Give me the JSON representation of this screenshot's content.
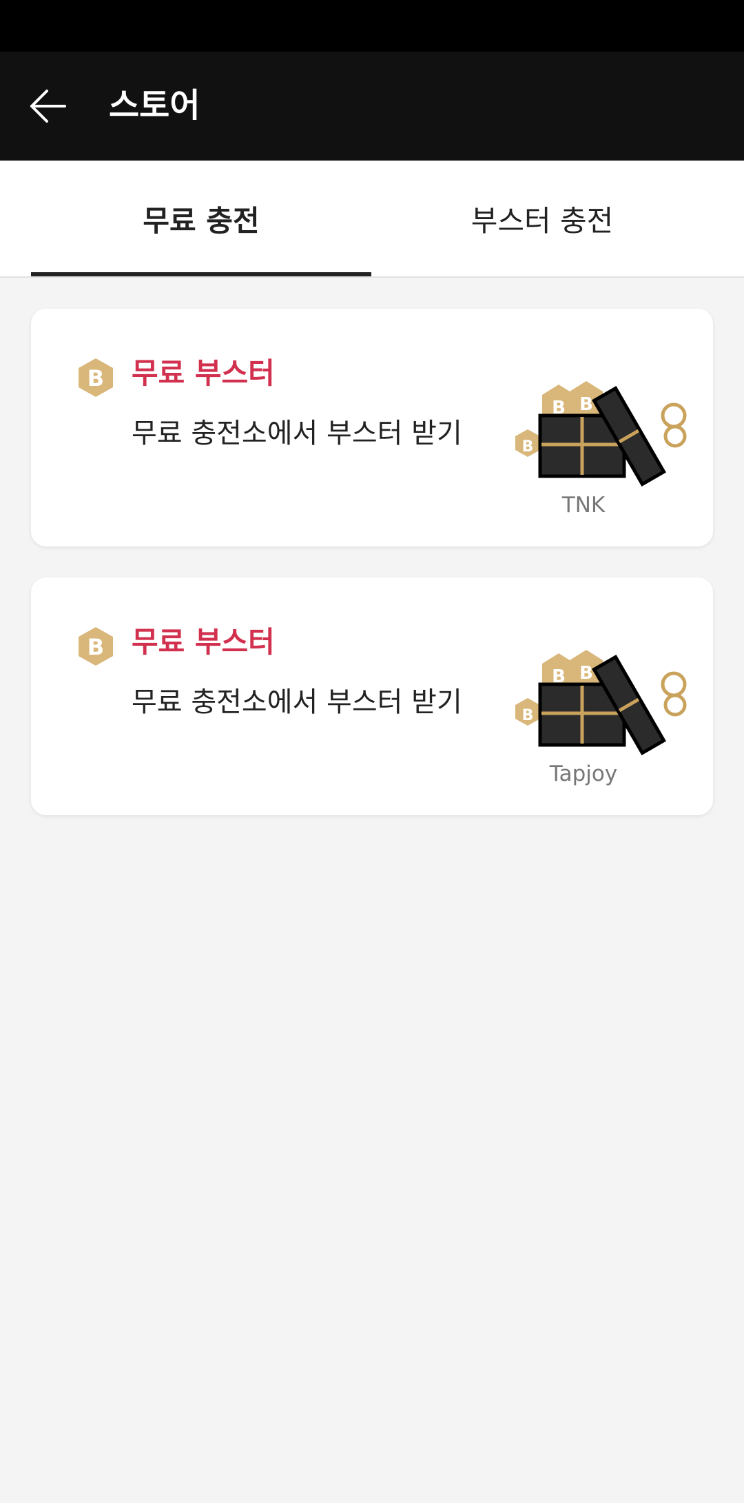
{
  "header": {
    "title": "스토어",
    "back_icon": "arrow-left-icon"
  },
  "tabs": [
    {
      "label": "무료 충전",
      "active": true
    },
    {
      "label": "부스터 충전",
      "active": false
    }
  ],
  "cards": [
    {
      "title": "무료 부스터",
      "description": "무료 충전소에서 부스터 받기",
      "provider": "TNK",
      "icon": "booster-coin-icon",
      "illustration": "gift-box-illustration"
    },
    {
      "title": "무료 부스터",
      "description": "무료 충전소에서 부스터 받기",
      "provider": "Tapjoy",
      "icon": "booster-coin-icon",
      "illustration": "gift-box-illustration"
    }
  ],
  "colors": {
    "header_bg": "#111111",
    "accent_red": "#d1304e",
    "gold": "#d9b77a",
    "background": "#f4f4f4"
  }
}
